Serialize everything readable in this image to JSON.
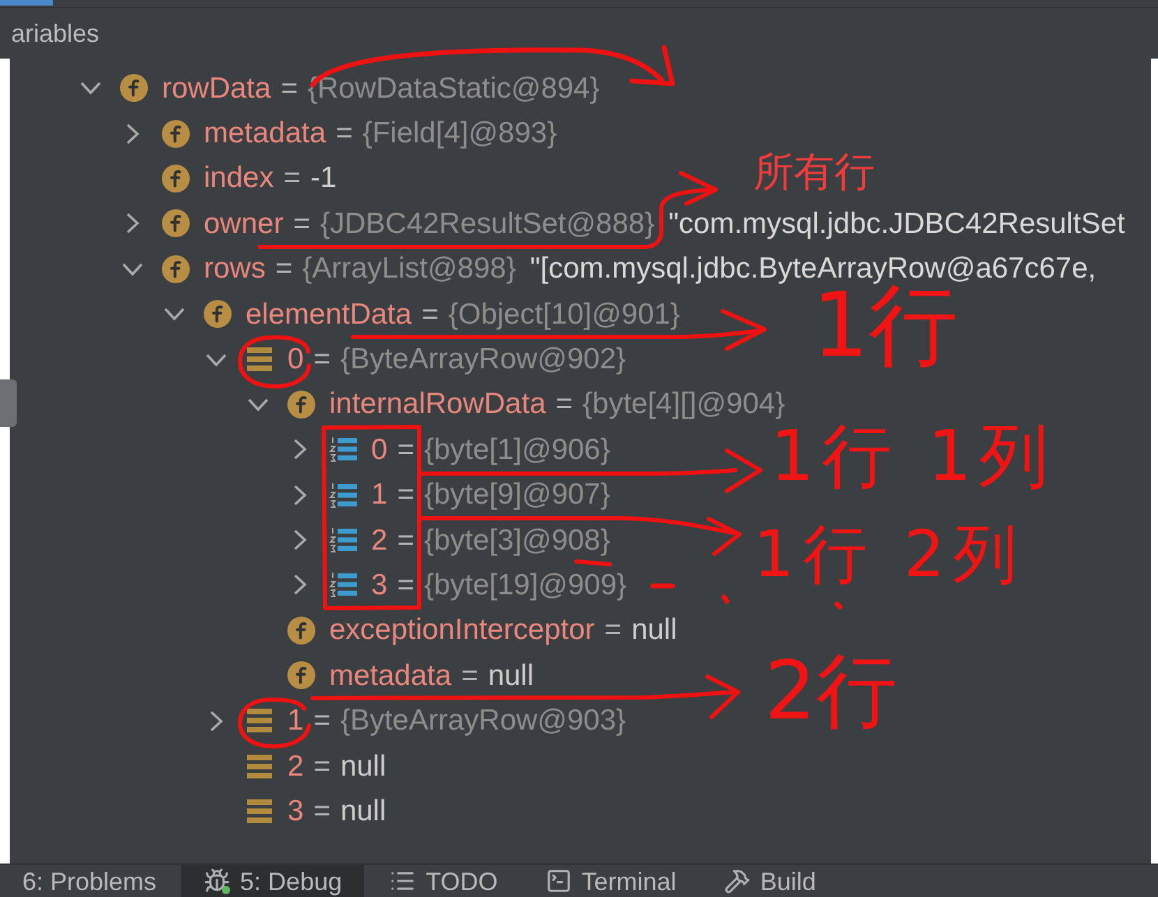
{
  "panel": {
    "title": "ariables"
  },
  "variables": [
    {
      "name": "rowData",
      "equals": "=",
      "value": "{RowDataStatic@894}",
      "literal": false,
      "kind": "field",
      "expanded": true,
      "children": [
        {
          "name": "metadata",
          "equals": "=",
          "value": "{Field[4]@893}",
          "literal": false,
          "kind": "field",
          "expanded": false
        },
        {
          "name": "index",
          "equals": "=",
          "value": "-1",
          "literal": true,
          "kind": "field"
        },
        {
          "name": "owner",
          "equals": "=",
          "value": "{JDBC42ResultSet@888}",
          "literal": false,
          "preview": "\"com.mysql.jdbc.JDBC42ResultSet",
          "kind": "field",
          "expanded": false
        },
        {
          "name": "rows",
          "equals": "=",
          "value": "{ArrayList@898}",
          "literal": false,
          "preview": "\"[com.mysql.jdbc.ByteArrayRow@a67c67e,",
          "kind": "field",
          "expanded": true,
          "children": [
            {
              "name": "elementData",
              "equals": "=",
              "value": "{Object[10]@901}",
              "literal": false,
              "kind": "field",
              "expanded": true,
              "children": [
                {
                  "name": "0",
                  "equals": "=",
                  "value": "{ByteArrayRow@902}",
                  "literal": false,
                  "kind": "element",
                  "expanded": true,
                  "children": [
                    {
                      "name": "internalRowData",
                      "equals": "=",
                      "value": "{byte[4][]@904}",
                      "literal": false,
                      "kind": "field",
                      "expanded": true,
                      "children": [
                        {
                          "name": "0",
                          "equals": "=",
                          "value": "{byte[1]@906}",
                          "literal": false,
                          "kind": "indexed",
                          "expanded": false
                        },
                        {
                          "name": "1",
                          "equals": "=",
                          "value": "{byte[9]@907}",
                          "literal": false,
                          "kind": "indexed",
                          "expanded": false
                        },
                        {
                          "name": "2",
                          "equals": "=",
                          "value": "{byte[3]@908}",
                          "literal": false,
                          "kind": "indexed",
                          "expanded": false
                        },
                        {
                          "name": "3",
                          "equals": "=",
                          "value": "{byte[19]@909}",
                          "literal": false,
                          "kind": "indexed",
                          "expanded": false
                        }
                      ]
                    },
                    {
                      "name": "exceptionInterceptor",
                      "equals": "=",
                      "value": "null",
                      "literal": true,
                      "kind": "field"
                    },
                    {
                      "name": "metadata",
                      "equals": "=",
                      "value": "null",
                      "literal": true,
                      "kind": "field"
                    }
                  ]
                },
                {
                  "name": "1",
                  "equals": "=",
                  "value": "{ByteArrayRow@903}",
                  "literal": false,
                  "kind": "element",
                  "expanded": false
                },
                {
                  "name": "2",
                  "equals": "=",
                  "value": "null",
                  "literal": true,
                  "kind": "element"
                },
                {
                  "name": "3",
                  "equals": "=",
                  "value": "null",
                  "literal": true,
                  "kind": "element"
                }
              ]
            }
          ]
        }
      ]
    }
  ],
  "annotations": [
    {
      "text": "所有行",
      "kind": "typed"
    },
    {
      "text": "1行",
      "kind": "handwritten"
    },
    {
      "text": "1行 1列",
      "kind": "handwritten"
    },
    {
      "text": "1行 2列",
      "kind": "handwritten"
    },
    {
      "text": "2行",
      "kind": "handwritten"
    }
  ],
  "tool_windows": [
    {
      "label": "6: Problems",
      "selected": false
    },
    {
      "label": "5: Debug",
      "selected": true
    },
    {
      "label": "TODO",
      "selected": false
    },
    {
      "label": "Terminal",
      "selected": false
    },
    {
      "label": "Build",
      "selected": false
    }
  ]
}
